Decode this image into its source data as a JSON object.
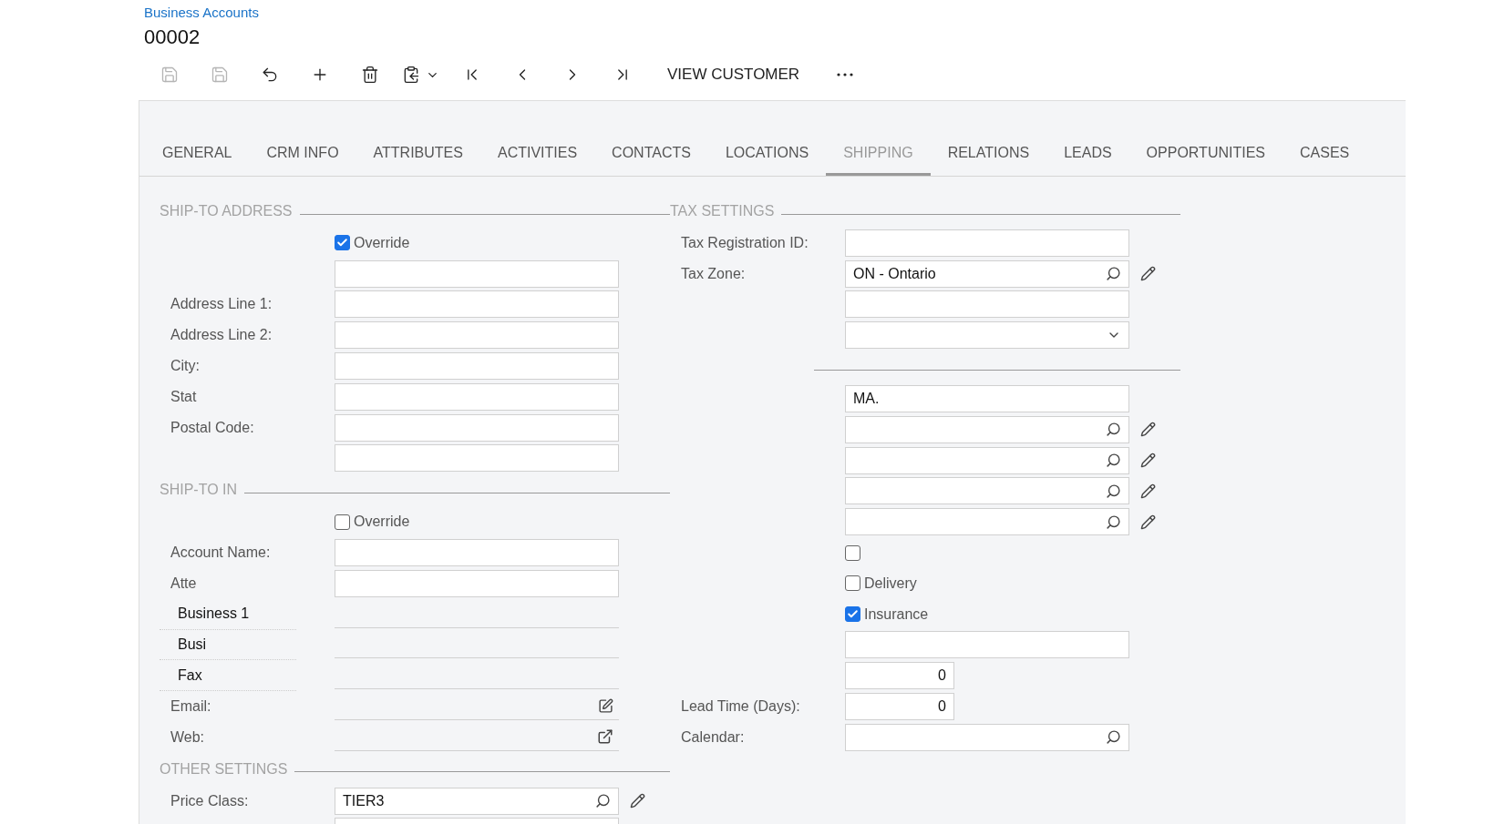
{
  "breadcrumb": "Business Accounts",
  "record_title": "00002",
  "toolbar": [
    {
      "kind": "save-close",
      "disabled": true
    },
    {
      "kind": "save",
      "disabled": true
    },
    {
      "kind": "undo",
      "disabled": false
    },
    {
      "kind": "add",
      "disabled": false
    },
    {
      "kind": "delete",
      "disabled": false
    },
    {
      "kind": "copy-paste",
      "disabled": false
    },
    {
      "kind": "first",
      "disabled": false
    },
    {
      "kind": "previous",
      "disabled": false
    },
    {
      "kind": "next",
      "disabled": false
    },
    {
      "kind": "last",
      "disabled": false
    },
    {
      "kind": "text",
      "label": "VIEW CUSTOMER",
      "disabled": false
    },
    {
      "kind": "more",
      "disabled": false
    }
  ],
  "tabs": [
    {
      "label": "GENERAL",
      "selected": false
    },
    {
      "label": "CRM INFO",
      "selected": false
    },
    {
      "label": "ATTRIBUTES",
      "selected": false
    },
    {
      "label": "ACTIVITIES",
      "selected": false
    },
    {
      "label": "CONTACTS",
      "selected": false
    },
    {
      "label": "LOCATIONS",
      "selected": false
    },
    {
      "label": "SHIPPING",
      "selected": true
    },
    {
      "label": "RELATIONS",
      "selected": false
    },
    {
      "label": "LEADS",
      "selected": false
    },
    {
      "label": "OPPORTUNITIES",
      "selected": false
    },
    {
      "label": "CASES",
      "selected": false
    }
  ],
  "left_sections": [
    {
      "title": "SHIP-TO ADDRESS",
      "rows": [
        {
          "kind": "checkbox",
          "label": "Override",
          "checked": true
        },
        {
          "kind": "field"
        },
        {
          "kind": "field",
          "label": "Address Line 1:"
        },
        {
          "kind": "field",
          "label": "Address Line 2:"
        },
        {
          "kind": "field",
          "label": "City:"
        },
        {
          "kind": "field",
          "label": "Stat"
        },
        {
          "kind": "field",
          "label": "Postal Code:"
        },
        {
          "kind": "field"
        }
      ]
    },
    {
      "title": "SHIP-TO IN",
      "rows": [
        {
          "kind": "checkbox",
          "label": "Override",
          "checked": false
        },
        {
          "kind": "field",
          "label": "Account Name:"
        },
        {
          "kind": "field",
          "label": "Atte"
        },
        {
          "kind": "phone",
          "label": "Business 1"
        },
        {
          "kind": "phone",
          "label": "Busi"
        },
        {
          "kind": "phone",
          "label": "Fax"
        },
        {
          "kind": "email",
          "label": "Email:"
        },
        {
          "kind": "web",
          "label": "Web:"
        }
      ]
    },
    {
      "title": "OTHER SETTINGS",
      "rows": [
        {
          "kind": "lookup",
          "label": "Price Class:",
          "value": "TIER3",
          "edit": true
        },
        {
          "kind": "field"
        }
      ]
    }
  ],
  "right_sections": [
    {
      "title": "TAX SETTINGS",
      "rows": [
        {
          "kind": "field",
          "label": "Tax Registration ID:"
        },
        {
          "kind": "lookup",
          "label": "Tax Zone:",
          "value": "ON - Ontario",
          "edit": true
        },
        {
          "kind": "field"
        },
        {
          "kind": "dropdown"
        }
      ]
    },
    {
      "rows": [
        {
          "kind": "field",
          "value": "MA."
        },
        {
          "kind": "lookup",
          "edit": true
        },
        {
          "kind": "lookup",
          "edit": true
        },
        {
          "kind": "lookup",
          "edit": true
        },
        {
          "kind": "lookup",
          "edit": true
        },
        {
          "kind": "checkbox",
          "checked": false
        },
        {
          "kind": "checkbox",
          "label": "Delivery",
          "checked": false
        },
        {
          "kind": "checkbox",
          "label": "Insurance",
          "checked": true
        },
        {
          "kind": "field"
        },
        {
          "kind": "number",
          "value": "0"
        },
        {
          "kind": "number",
          "label": "Lead Time (Days):",
          "value": "0"
        },
        {
          "kind": "lookup",
          "label": "Calendar:",
          "edit": false
        }
      ]
    }
  ]
}
